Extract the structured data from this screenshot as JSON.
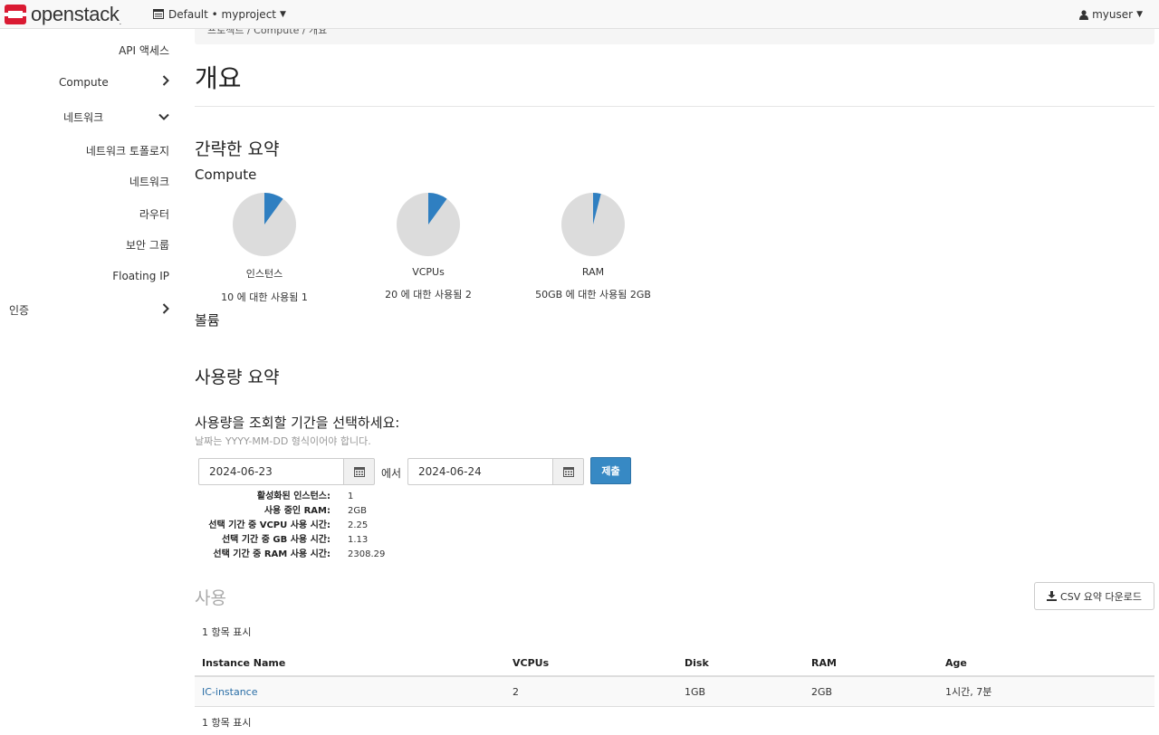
{
  "navbar": {
    "brand": "openstack",
    "brand_mark": ".",
    "project": "Default • myproject",
    "user": "myuser"
  },
  "sidebar": {
    "items": [
      {
        "label": "API 액세스"
      },
      {
        "label": "Compute"
      },
      {
        "label": "네트워크"
      },
      {
        "label": "네트워크 토폴로지"
      },
      {
        "label": "네트워크"
      },
      {
        "label": "라우터"
      },
      {
        "label": "보안 그룹"
      },
      {
        "label": "Floating IP"
      },
      {
        "label": "인증"
      }
    ]
  },
  "breadcrumb": "프로젝트 / Compute / 개요",
  "page_title": "개요",
  "limit_summary": {
    "heading": "간략한 요약",
    "compute_heading": "Compute",
    "volume_heading": "볼륨",
    "pies": [
      {
        "name": "인스턴스",
        "usage_text": "10 에 대한 사용됨 1",
        "used": 1,
        "total": 10
      },
      {
        "name": "VCPUs",
        "usage_text": "20 에 대한 사용됨 2",
        "used": 2,
        "total": 20
      },
      {
        "name": "RAM",
        "usage_text": "50GB 에 대한 사용됨 2GB",
        "used": 2,
        "total": 50
      }
    ],
    "colors": {
      "used": "#2f7fc1",
      "free": "#dcdcdc"
    }
  },
  "usage_summary": {
    "heading": "사용량 요약",
    "period_heading": "사용량을 조회할 기간을 선택하세요:",
    "help": "날짜는 YYYY-MM-DD 형식이어야 합니다.",
    "start_date": "2024-06-23",
    "separator": "에서",
    "end_date": "2024-06-24",
    "submit": "제출",
    "stats": [
      {
        "label": "활성화된 인스턴스:",
        "value": "1"
      },
      {
        "label": "사용 중인 RAM:",
        "value": "2GB"
      },
      {
        "label": "선택 기간 중 VCPU 사용 시간:",
        "value": "2.25"
      },
      {
        "label": "선택 기간 중 GB 사용 시간:",
        "value": "1.13"
      },
      {
        "label": "선택 기간 중 RAM 사용 시간:",
        "value": "2308.29"
      }
    ]
  },
  "usage": {
    "title": "사용",
    "csv_button": "CSV 요약 다운로드",
    "count_top": "1 항목 표시",
    "count_bottom": "1 항목 표시",
    "columns": [
      "Instance Name",
      "VCPUs",
      "Disk",
      "RAM",
      "Age"
    ],
    "rows": [
      [
        "IC-instance",
        "2",
        "1GB",
        "2GB",
        "1시간, 7분"
      ]
    ]
  }
}
